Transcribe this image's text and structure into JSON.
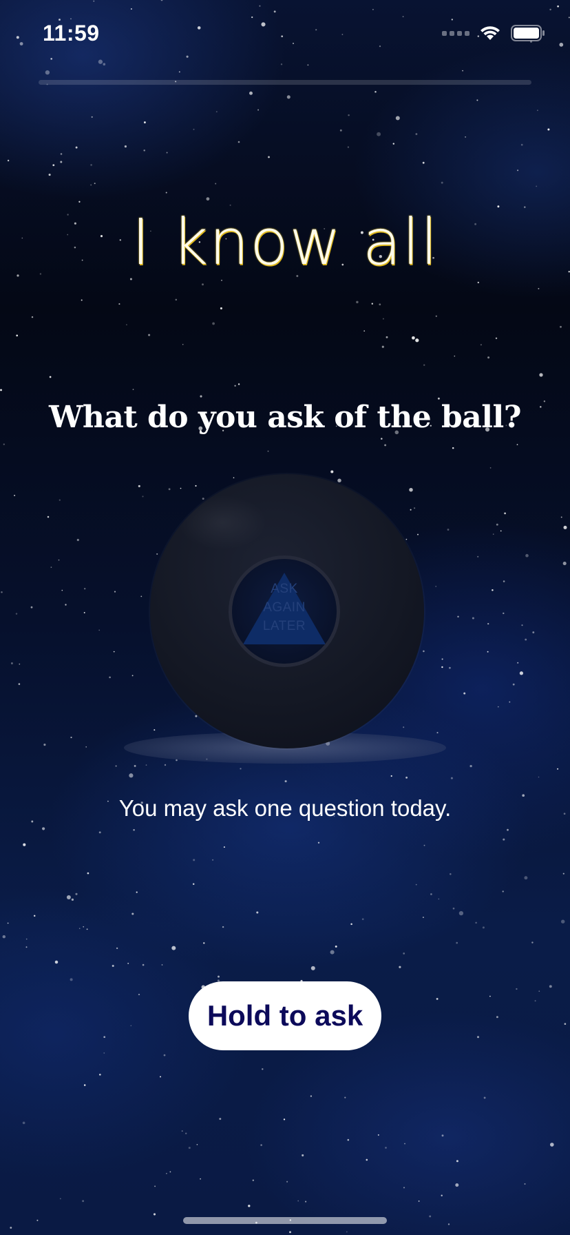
{
  "status_bar": {
    "time": "11:59",
    "icons": [
      "cellular-signal-icon",
      "wifi-icon",
      "battery-icon"
    ]
  },
  "progress": {
    "fraction": 0
  },
  "header": {
    "title": "I know all"
  },
  "prompt": {
    "question": "What do you ask of the ball?"
  },
  "ball": {
    "answer_lines": [
      "ASK",
      "AGAIN",
      "LATER"
    ]
  },
  "info": {
    "limit_text": "You may ask one question today."
  },
  "actions": {
    "hold_label": "Hold to ask"
  },
  "colors": {
    "title": "#fffbea",
    "title_glow": "#f3cf2c",
    "button_bg": "#ffffff",
    "button_text": "#0c0a5a",
    "background": "#050a1e"
  }
}
